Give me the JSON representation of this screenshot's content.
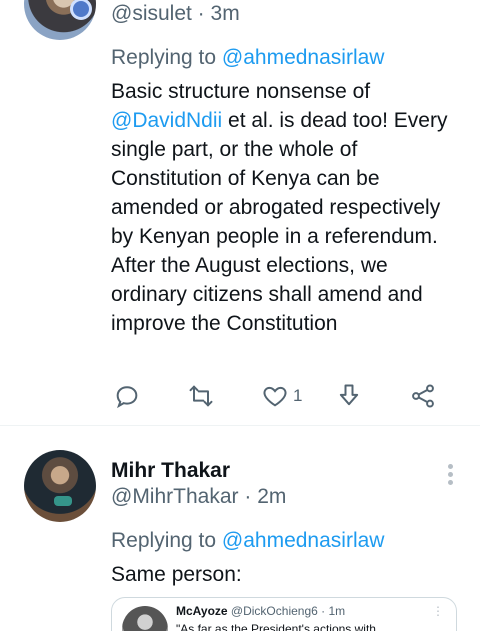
{
  "tweet1": {
    "handle": "@sisulet",
    "sep": " · ",
    "time": "3m",
    "replying_prefix": "Replying to ",
    "replying_to": "@ahmednasirlaw",
    "text_before_mention": "Basic structure nonsense of ",
    "mention": "@DavidNdii",
    "text_after_mention": " et al. is dead too! Every single part, or the whole of Constitution of Kenya can be amended or abrogated respectively by Kenyan people in a referendum. After the August elections, we ordinary citizens shall amend and improve the Constitution",
    "like_count": "1",
    "icons": [
      "reply-icon",
      "retweet-icon",
      "like-icon",
      "download-icon",
      "share-icon"
    ]
  },
  "tweet2": {
    "name": "Mihr Thakar",
    "handle": "@MihrThakar",
    "sep": " · ",
    "time": "2m",
    "replying_prefix": "Replying to ",
    "replying_to": "@ahmednasirlaw",
    "text": "Same person:",
    "quote": {
      "name": "McAyoze",
      "handle": "@DickOchieng6",
      "sep": " · ",
      "time": "1m",
      "text": "\"As far as the President's actions with"
    }
  },
  "colors": {
    "link": "#1d9bf0",
    "secondary_text": "#536471",
    "primary_text": "#0f1419",
    "divider": "#eff3f4"
  }
}
